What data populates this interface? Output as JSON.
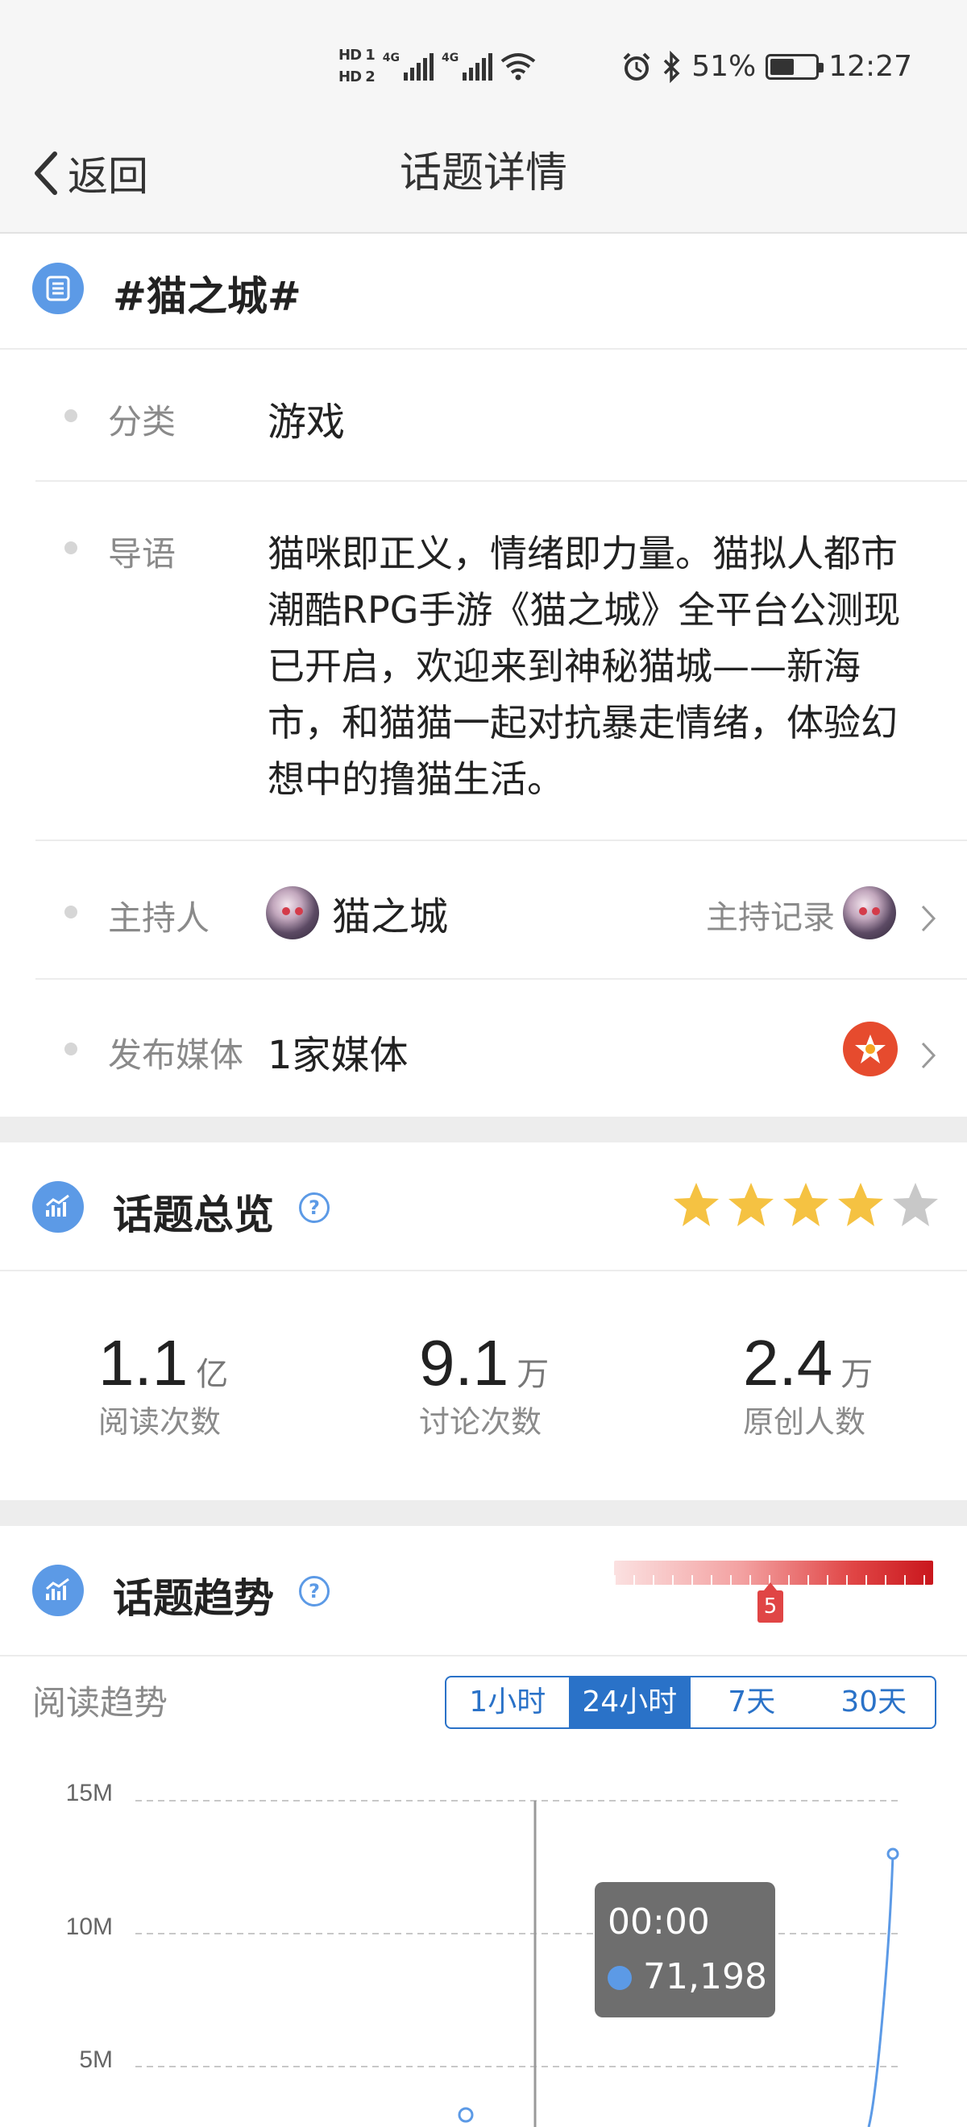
{
  "status_bar": {
    "hd1": "HD 1",
    "hd2": "HD 2",
    "net1": "4G",
    "net2": "4G",
    "battery": "51%",
    "battery_level": 0.51,
    "time": "12:27"
  },
  "nav": {
    "back_label": "返回",
    "title": "话题详情"
  },
  "topic": {
    "title": "#猫之城#",
    "category_label": "分类",
    "category_value": "游戏",
    "intro_label": "导语",
    "intro_text": "猫咪即正义，情绪即力量。猫拟人都市潮酷RPG手游《猫之城》全平台公测现已开启，欢迎来到神秘猫城——新海市，和猫猫一起对抗暴走情绪，体验幻想中的撸猫生活。",
    "host_label": "主持人",
    "host_name": "猫之城",
    "host_record": "主持记录",
    "media_label": "发布媒体",
    "media_value": "1家媒体"
  },
  "overview": {
    "title": "话题总览",
    "rating": 4,
    "rating_max": 5,
    "stats": [
      {
        "num": "1.1",
        "unit": "亿",
        "caption": "阅读次数"
      },
      {
        "num": "9.1",
        "unit": "万",
        "caption": "讨论次数"
      },
      {
        "num": "2.4",
        "unit": "万",
        "caption": "原创人数"
      }
    ]
  },
  "trend": {
    "title": "话题趋势",
    "heat_value": "5",
    "read_trend_label": "阅读趋势",
    "ranges": [
      "1小时",
      "24小时",
      "7天",
      "30天"
    ],
    "active_range": "24小时",
    "tooltip_time": "00:00",
    "tooltip_value": "71,198"
  },
  "colors": {
    "accent": "#5c9ae6",
    "segment": "#2a72c8",
    "heat_marker": "#e04545",
    "star_on": "#f5c242",
    "star_off": "#c8c8c8"
  },
  "chart_data": {
    "type": "line",
    "yticks": [
      "15M",
      "10M",
      "5M"
    ],
    "ylim": [
      0,
      15000000
    ],
    "series": [
      {
        "values": [
          {
            "x": "00:00",
            "y": 71198
          },
          {
            "x": "23:00",
            "y": 13000000
          }
        ]
      }
    ]
  }
}
